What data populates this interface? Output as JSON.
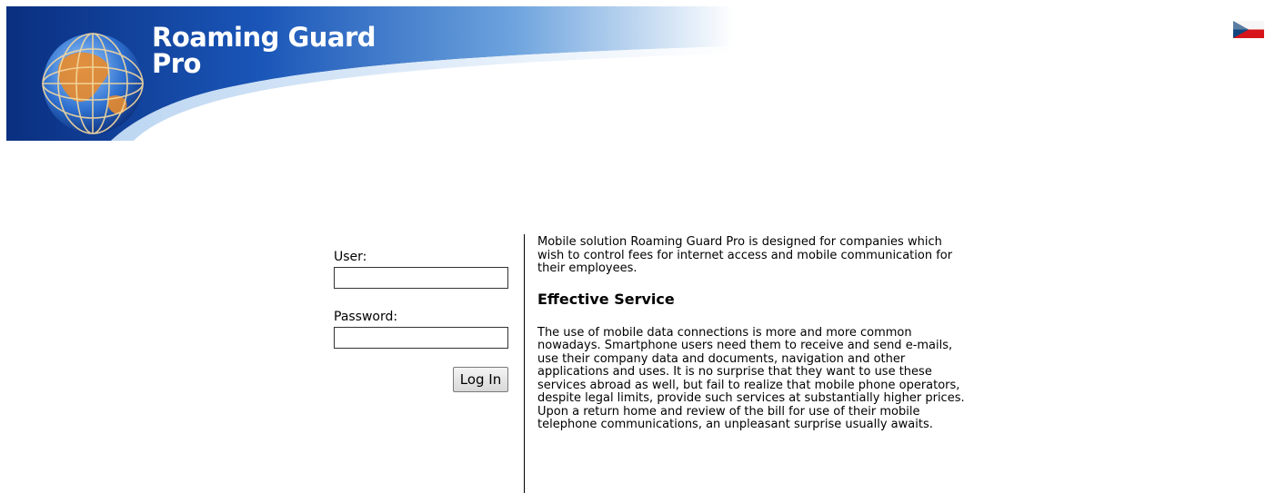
{
  "header": {
    "app_name_line1": "Roaming Guard",
    "app_name_line2": "Pro",
    "language_flag": "czech-flag-icon"
  },
  "login": {
    "user_label": "User:",
    "user_value": "",
    "password_label": "Password:",
    "password_value": "",
    "submit_label": "Log In"
  },
  "info": {
    "intro": "Mobile solution Roaming Guard Pro is designed for companies which wish to control fees for internet access and mobile communication for their employees.",
    "heading": "Effective Service",
    "body": "The use of mobile data connections is more and more common nowadays. Smartphone users need them to receive and send e-mails, use their company data and documents, navigation and other applications and uses. It is no surprise that they want to use these services abroad as well, but fail to realize that mobile phone operators, despite legal limits, provide such services at substantially higher prices. Upon a return home and review of the bill for use of their mobile telephone communications, an unpleasant surprise usually awaits."
  },
  "colors": {
    "banner_dark": "#0a2f80",
    "banner_mid": "#2a6fd0",
    "banner_light": "#cfe3f7",
    "globe_orange": "#e88a2a"
  }
}
